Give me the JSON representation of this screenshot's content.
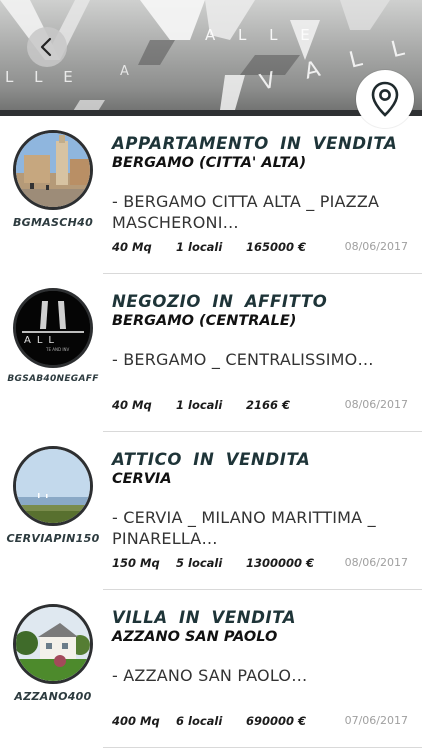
{
  "header": {
    "brand_text": "VALLE",
    "back_icon": "chevron-left-icon",
    "map_icon": "map-pin-icon"
  },
  "listings": [
    {
      "title": "APPARTAMENTO IN VENDITA",
      "city": "BERGAMO (CITTA' ALTA)",
      "desc_line1": "- BERGAMO CITTA ALTA _ PIAZZA",
      "desc_line2": "MASCHERONI…",
      "code": "BGMASCH40",
      "size": "40 Mq",
      "rooms": "1 locali",
      "price": "165000 €",
      "date": "08/06/2017",
      "thumb": "photo-piazza"
    },
    {
      "title": "NEGOZIO IN AFFITTO",
      "city": "BERGAMO (CENTRALE)",
      "desc_line1": "- BERGAMO _ CENTRALISSIMO…",
      "desc_line2": "",
      "code": "BGSAB40NEGAFF",
      "size": "40 Mq",
      "rooms": "1 locali",
      "price": "2166 €",
      "date": "08/06/2017",
      "thumb": "photo-logo"
    },
    {
      "title": "ATTICO IN VENDITA",
      "city": "CERVIA",
      "desc_line1": "- CERVIA _ MILANO MARITTIMA _",
      "desc_line2": "PINARELLA…",
      "code": "CERVIAPIN150",
      "size": "150 Mq",
      "rooms": "5 locali",
      "price": "1300000 €",
      "date": "08/06/2017",
      "thumb": "photo-sea"
    },
    {
      "title": "VILLA IN VENDITA",
      "city": "AZZANO SAN PAOLO",
      "desc_line1": "- AZZANO SAN PAOLO…",
      "desc_line2": "",
      "code": "AZZANO400",
      "size": "400 Mq",
      "rooms": "6 locali",
      "price": "690000 €",
      "date": "07/06/2017",
      "thumb": "photo-villa"
    }
  ]
}
